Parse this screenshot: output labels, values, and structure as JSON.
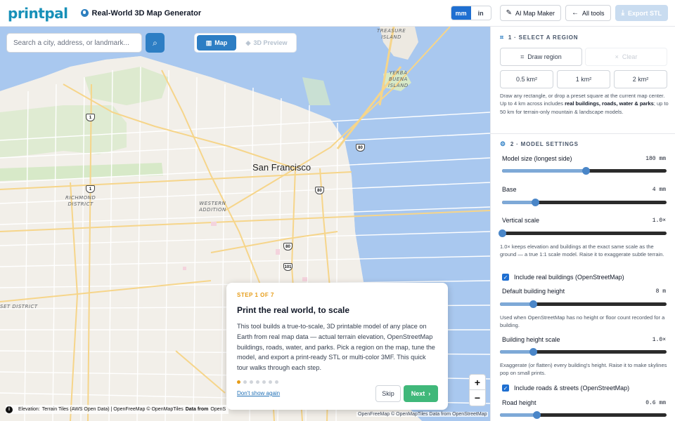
{
  "header": {
    "logo": "printpal",
    "title": "Real-World 3D Map Generator",
    "units": [
      "mm",
      "in"
    ],
    "active_unit": "mm",
    "ai_label": "AI Map Maker",
    "tools_label": "All tools",
    "export_label": "Export STL"
  },
  "map": {
    "search_placeholder": "Search a city, address, or landmark...",
    "tab_map": "Map",
    "tab_3d": "3D Preview",
    "city": "San Francisco",
    "labels": {
      "treasure": "TREASURE\nISLAND",
      "yerba": "YERBA\nBUENA\nISLAND",
      "richmond": "RICHMOND\nDISTRICT",
      "western": "WESTERN\nADDITION",
      "sunset": "SET DISTRICT"
    },
    "shields": [
      "1",
      "1",
      "80",
      "80",
      "80",
      "101"
    ],
    "zoom_in": "+",
    "zoom_out": "−",
    "attribution_prefix": "Elevation:",
    "attribution_text": "Terrain Tiles (AWS Open Data) | OpenFreeMap © OpenMapTiles",
    "attribution_bold": "Data from",
    "attribution_tail": "OpenS",
    "attribution_right": "OpenFreeMap © OpenMapTiles Data from OpenStreetMap"
  },
  "tour": {
    "step": "STEP 1 OF 7",
    "title": "Print the real world, to scale",
    "body": "This tool builds a true-to-scale, 3D printable model of any place on Earth from real map data — actual terrain elevation, OpenStreetMap buildings, roads, water, and parks. Pick a region on the map, tune the model, and export a print-ready STL or multi-color 3MF. This quick tour walks through each step.",
    "total_steps": 7,
    "current_step": 1,
    "dont_show": "Don't show again",
    "skip": "Skip",
    "next": "Next"
  },
  "panel": {
    "region": {
      "heading": "1 · SELECT A REGION",
      "draw": "Draw region",
      "clear": "Clear",
      "presets": [
        "0.5 km²",
        "1 km²",
        "2 km²"
      ],
      "note_a": "Draw any rectangle, or drop a preset square at the current map center. Up to 4 km across includes ",
      "note_b": "real buildings, roads, water & parks",
      "note_c": "; up to 50 km for terrain-only mountain & landscape models."
    },
    "model": {
      "heading": "2 · MODEL SETTINGS",
      "size_label": "Model size (longest side)",
      "size_value": "180 mm",
      "size_fraction": 0.51,
      "base_label": "Base",
      "base_value": "4 mm",
      "base_fraction": 0.2,
      "vscale_label": "Vertical scale",
      "vscale_value": "1.0×",
      "vscale_fraction": 0.0,
      "vscale_note": "1.0× keeps elevation and buildings at the exact same scale as the ground — a true 1:1 scale model. Raise it to exaggerate subtle terrain.",
      "buildings_check": "Include real buildings (OpenStreetMap)",
      "bheight_label": "Default building height",
      "bheight_value": "8 m",
      "bheight_fraction": 0.2,
      "bheight_note": "Used when OpenStreetMap has no height or floor count recorded for a building.",
      "bscale_label": "Building height scale",
      "bscale_value": "1.0×",
      "bscale_fraction": 0.2,
      "bscale_note": "Exaggerate (or flatten) every building's height. Raise it to make skylines pop on small prints.",
      "roads_check": "Include roads & streets (OpenStreetMap)",
      "road_label": "Road height",
      "road_value": "0.6 mm",
      "road_fraction": 0.22
    }
  }
}
